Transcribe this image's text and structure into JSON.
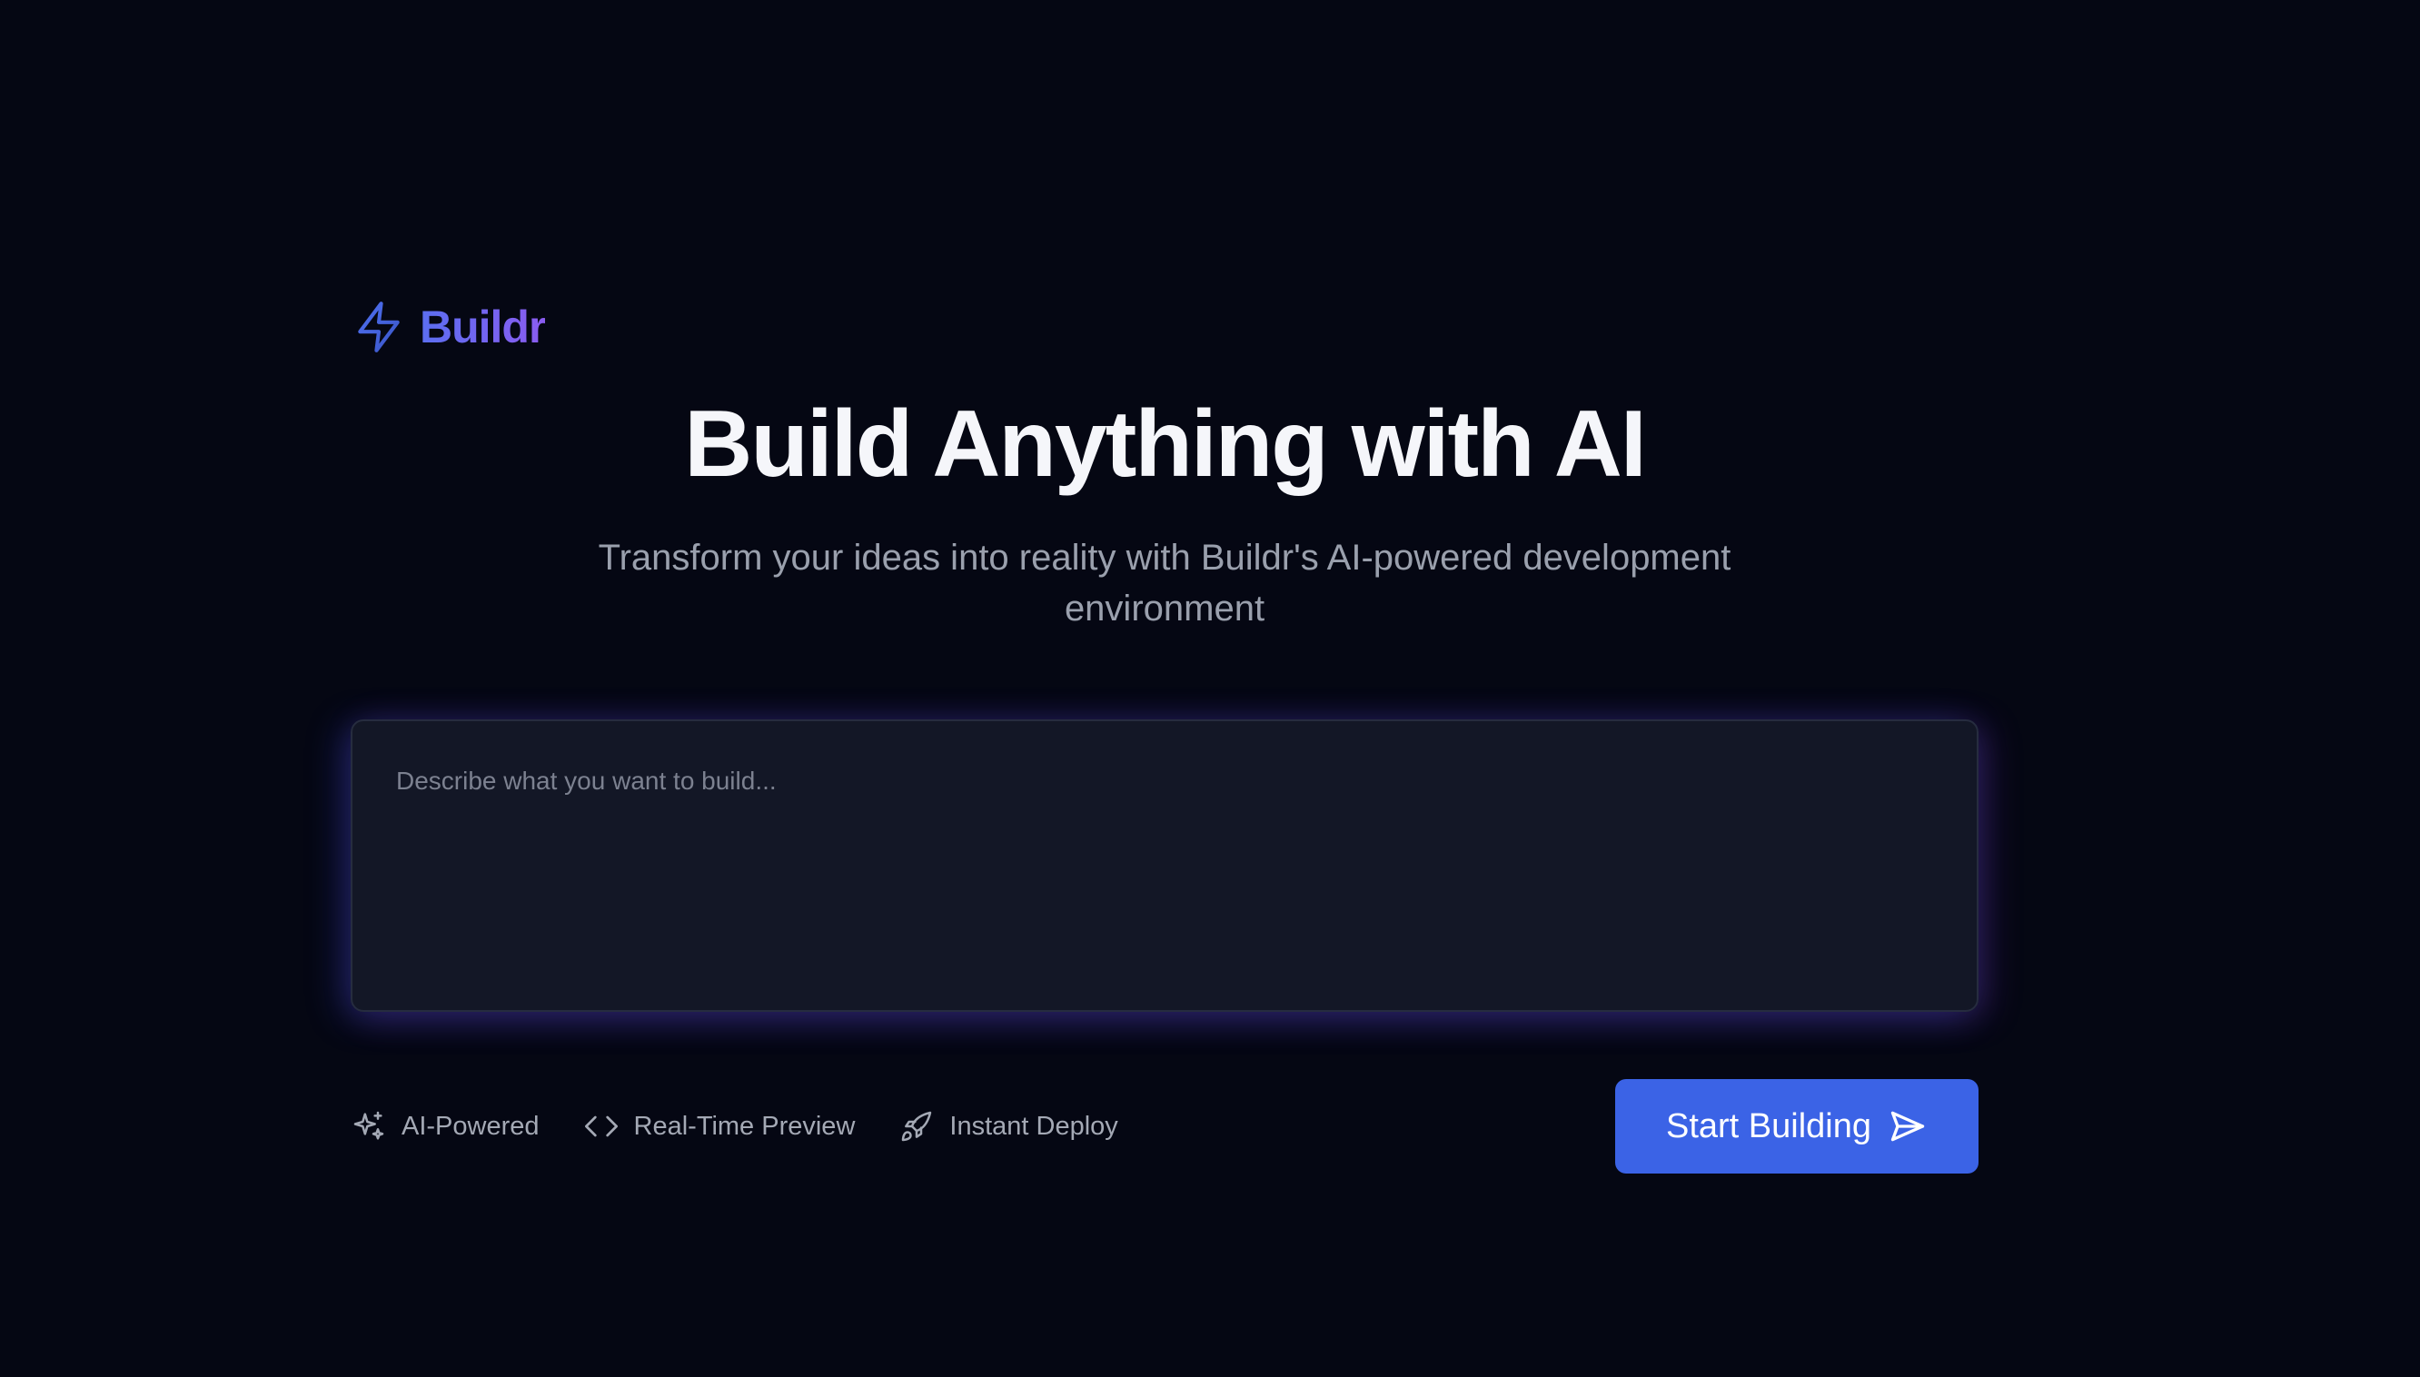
{
  "brand": {
    "name": "Buildr",
    "icon": "lightning-bolt-icon",
    "gradient_start": "#5b6ef0",
    "gradient_end": "#8a5cf0"
  },
  "hero": {
    "title": "Build Anything with AI",
    "subtitle": "Transform your ideas into reality with Buildr's AI-powered development environment"
  },
  "prompt": {
    "placeholder": "Describe what you want to build...",
    "value": ""
  },
  "features": [
    {
      "label": "AI-Powered",
      "icon": "sparkles-icon"
    },
    {
      "label": "Real-Time Preview",
      "icon": "code-icon"
    },
    {
      "label": "Instant Deploy",
      "icon": "rocket-icon"
    }
  ],
  "cta": {
    "label": "Start Building",
    "icon": "send-icon",
    "color": "#3b63e6"
  },
  "colors": {
    "background": "#050713",
    "input_background": "#131726"
  }
}
